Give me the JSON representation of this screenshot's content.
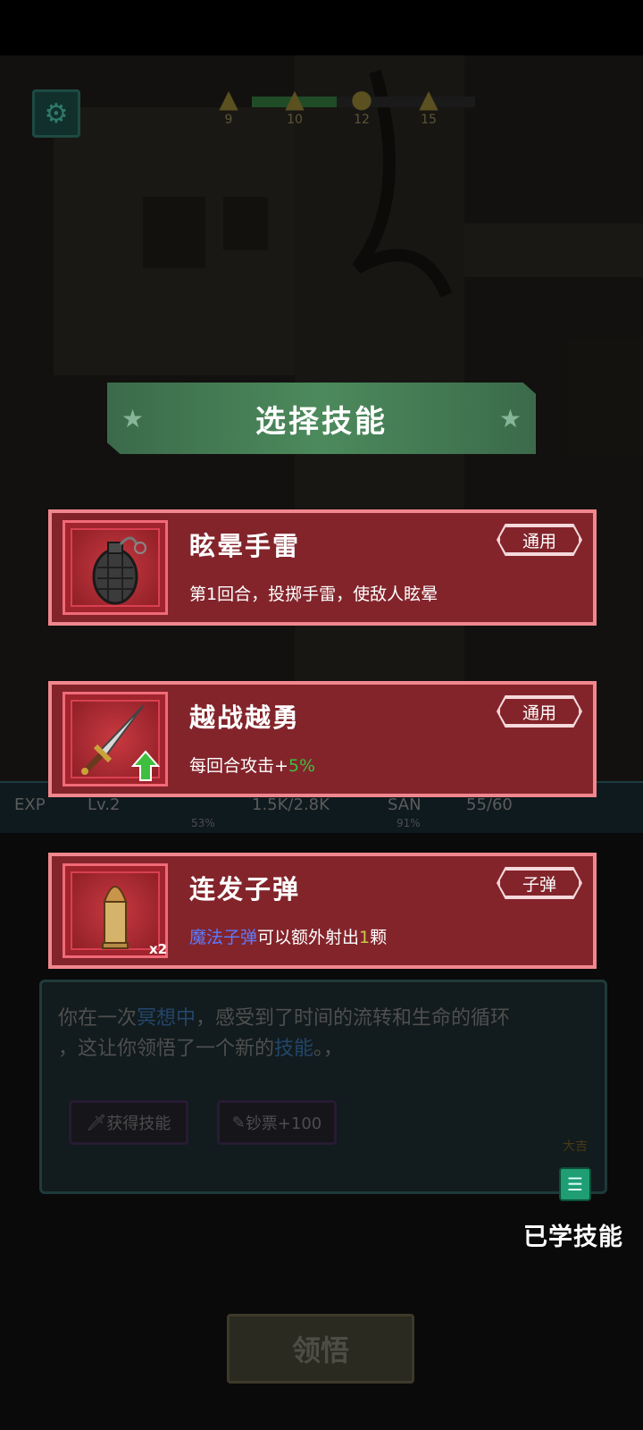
{
  "dialog": {
    "title": "选择技能"
  },
  "skills": [
    {
      "name": "眩晕手雷",
      "tag": "通用",
      "desc_parts": [
        "第1回合，投掷手雷，使敌人眩晕"
      ],
      "icon": "grenade-icon"
    },
    {
      "name": "越战越勇",
      "tag": "通用",
      "desc_parts": [
        "每回合攻击+",
        "5%"
      ],
      "icon": "dagger-icon"
    },
    {
      "name": "连发子弹",
      "tag": "子弹",
      "desc_parts": [
        "魔法子弹",
        "可以额外射出",
        "1",
        "颗"
      ],
      "icon": "bullet-icon",
      "badge": "x2"
    }
  ],
  "hud": {
    "warnings": [
      "9",
      "10",
      "12",
      "15"
    ],
    "progress": 0.38,
    "level": "Lv.2",
    "exp_label": "EXP",
    "hp_value": "1.5K/2.8K",
    "hp_percent": "53%",
    "san_label": "SAN",
    "san_value": "55/60",
    "san_percent": "91%"
  },
  "story": {
    "line1_a": "你在一次",
    "line1_hl": "冥想中",
    "line1_b": "，感受到了时间的流转和生命的循环",
    "line2_a": "，这让你领悟了一个新的",
    "line2_hl": "技能",
    "line2_b": "。，",
    "btn_skill": "获得技能",
    "btn_money": "钞票+100",
    "luck": "大吉"
  },
  "learned_label": "已学技能",
  "confirm_label": "领悟",
  "colors": {
    "card_bg": "#83242b",
    "card_border": "#f1878e",
    "banner": "#4c8a5c",
    "accent_green": "#3fbf3f",
    "accent_blue": "#5a7bff"
  }
}
